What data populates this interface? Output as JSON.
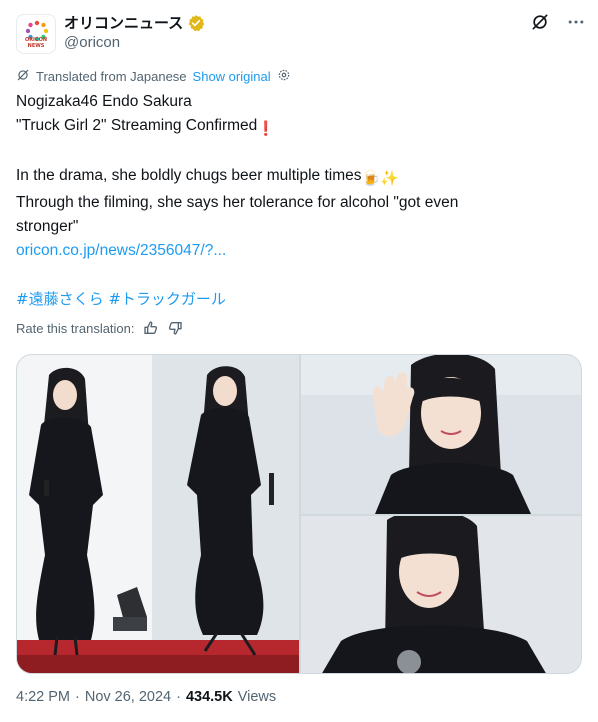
{
  "account": {
    "display_name": "オリコンニュース",
    "handle": "@oricon",
    "avatar_text": "ORICON NEWS",
    "verified_color": "#e2b719"
  },
  "translation": {
    "notice": "Translated from Japanese",
    "show_original": "Show original"
  },
  "tweet": {
    "line1": "Nogizaka46 Endo Sakura",
    "line2": "\"Truck Girl 2\" Streaming Confirmed",
    "line2_emoji": "❗",
    "line3": "In the drama, she boldly chugs beer multiple times",
    "line3_emoji": "🍺✨",
    "line4": "Through the filming, she says her tolerance for alcohol \"got even",
    "line5": "stronger\"",
    "link": "oricon.co.jp/news/2356047/?...",
    "hashtags": "#遠藤さくら #トラックガール"
  },
  "rate": {
    "label": "Rate this translation:"
  },
  "media": {
    "photo_count": 3
  },
  "footer": {
    "time": "4:22 PM",
    "separator": "·",
    "date": "Nov 26, 2024",
    "separator2": "·",
    "views_count": "434.5K",
    "views_label": "Views"
  },
  "colors": {
    "accent": "#1d9bf0",
    "text": "#0f1419",
    "muted": "#536471"
  }
}
